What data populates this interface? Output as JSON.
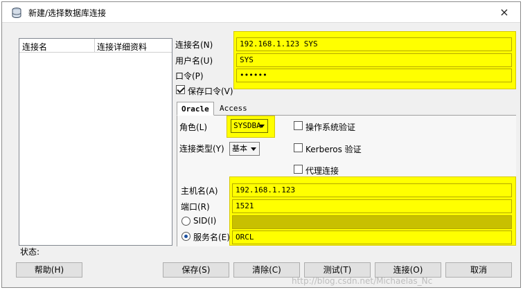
{
  "window": {
    "title": "新建/选择数据库连接",
    "close": "×"
  },
  "connections_table": {
    "columns": [
      "连接名",
      "连接详细资料"
    ]
  },
  "form": {
    "conn_name_label": "连接名(N)",
    "conn_name_value": "192.168.1.123 SYS",
    "username_label": "用户名(U)",
    "username_value": "SYS",
    "password_label": "口令(P)",
    "password_value": "••••••",
    "save_password_label": "保存口令(V)",
    "save_password_checked": true
  },
  "tabs": [
    {
      "label": "Oracle",
      "active": true
    },
    {
      "label": "Access",
      "active": false
    }
  ],
  "oracle": {
    "role_label": "角色(L)",
    "role_value": "SYSDBA",
    "conn_type_label": "连接类型(Y)",
    "conn_type_value": "基本",
    "os_auth_label": "操作系统验证",
    "kerberos_label": "Kerberos 验证",
    "proxy_label": "代理连接",
    "host_label": "主机名(A)",
    "host_value": "192.168.1.123",
    "port_label": "端口(R)",
    "port_value": "1521",
    "sid_label": "SID(I)",
    "sid_value": "",
    "service_label": "服务名(E)",
    "service_value": "ORCL"
  },
  "status_label": "状态:",
  "buttons": {
    "help": "帮助(H)",
    "save": "保存(S)",
    "clear": "清除(C)",
    "test": "测试(T)",
    "connect": "连接(O)",
    "cancel": "取消"
  },
  "watermark": "http://blog.csdn.net/Michaelas_Nc",
  "colors": {
    "highlight": "#ffff00",
    "sid_field": "#c8c000"
  },
  "icons": {
    "app": "database-icon"
  }
}
